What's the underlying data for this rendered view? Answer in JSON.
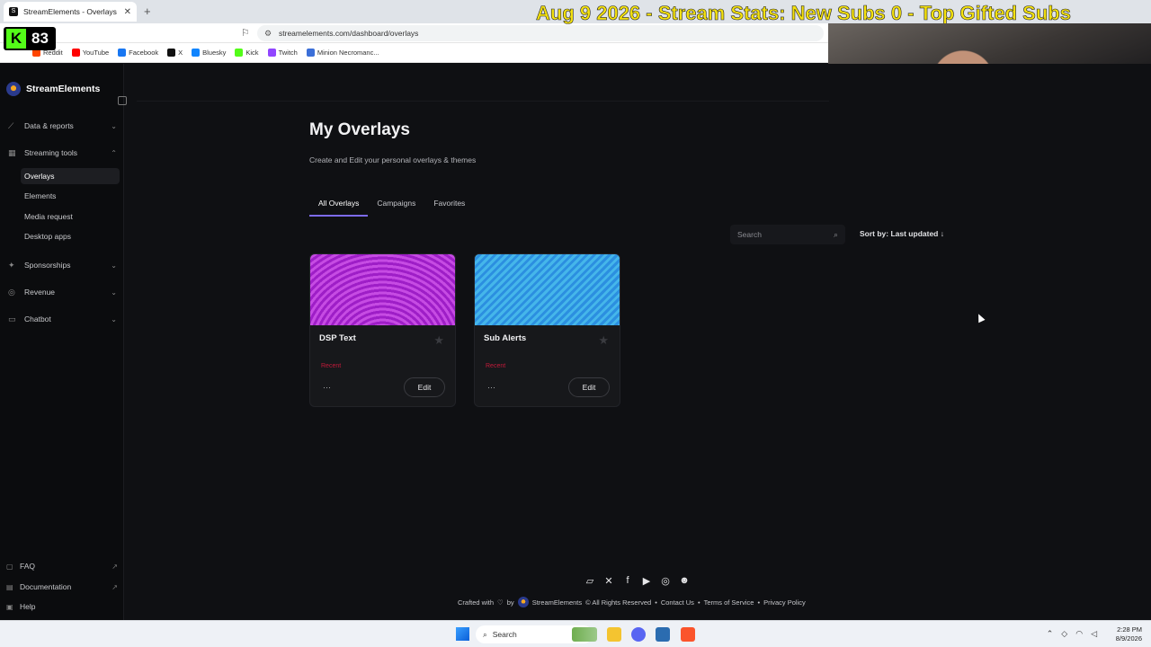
{
  "browser": {
    "tab_title": "StreamElements - Overlays",
    "url": "streamelements.com/dashboard/overlays",
    "bookmarks": [
      {
        "label": "Reddit",
        "color": "#ff4500"
      },
      {
        "label": "YouTube",
        "color": "#ff0000"
      },
      {
        "label": "Facebook",
        "color": "#1877f2"
      },
      {
        "label": "X",
        "color": "#111111"
      },
      {
        "label": "Bluesky",
        "color": "#1185fe"
      },
      {
        "label": "Kick",
        "color": "#53fc18"
      },
      {
        "label": "Twitch",
        "color": "#9146ff"
      },
      {
        "label": "Minion Necromanc...",
        "color": "#3b6fd8"
      }
    ]
  },
  "stream": {
    "kick_count": "83",
    "ticker": "Aug 9 2026 - Stream Stats: New Subs 0 - Top Gifted Subs"
  },
  "sidebar": {
    "brand": "StreamElements",
    "data_reports": "Data & reports",
    "streaming_tools": "Streaming tools",
    "sub_items": [
      "Overlays",
      "Elements",
      "Media request",
      "Desktop apps"
    ],
    "sponsorships": "Sponsorships",
    "revenue": "Revenue",
    "chatbot": "Chatbot",
    "faq": "FAQ",
    "documentation": "Documentation",
    "help": "Help"
  },
  "main": {
    "title": "My Overlays",
    "subtitle": "Create and Edit your personal overlays & themes",
    "tabs": [
      "All Overlays",
      "Campaigns",
      "Favorites"
    ],
    "search_placeholder": "Search",
    "sort_label": "Sort by: Last updated",
    "cards": [
      {
        "name": "DSP Text",
        "tag": "Recent",
        "edit": "Edit",
        "menu": "···"
      },
      {
        "name": "Sub Alerts",
        "tag": "Recent",
        "edit": "Edit",
        "menu": "···"
      }
    ]
  },
  "footer": {
    "crafted": "Crafted with",
    "by": "by",
    "brand": "StreamElements",
    "rights": "© All Rights Reserved",
    "contact": "Contact Us",
    "terms": "Terms of Service",
    "privacy": "Privacy Policy"
  },
  "taskbar": {
    "search": "Search",
    "time": "2:28 PM",
    "date": "8/9/2026"
  },
  "colors": {
    "accent": "#7d6bf0",
    "recent": "#c21a3a",
    "ticker": "#f5e20e"
  }
}
